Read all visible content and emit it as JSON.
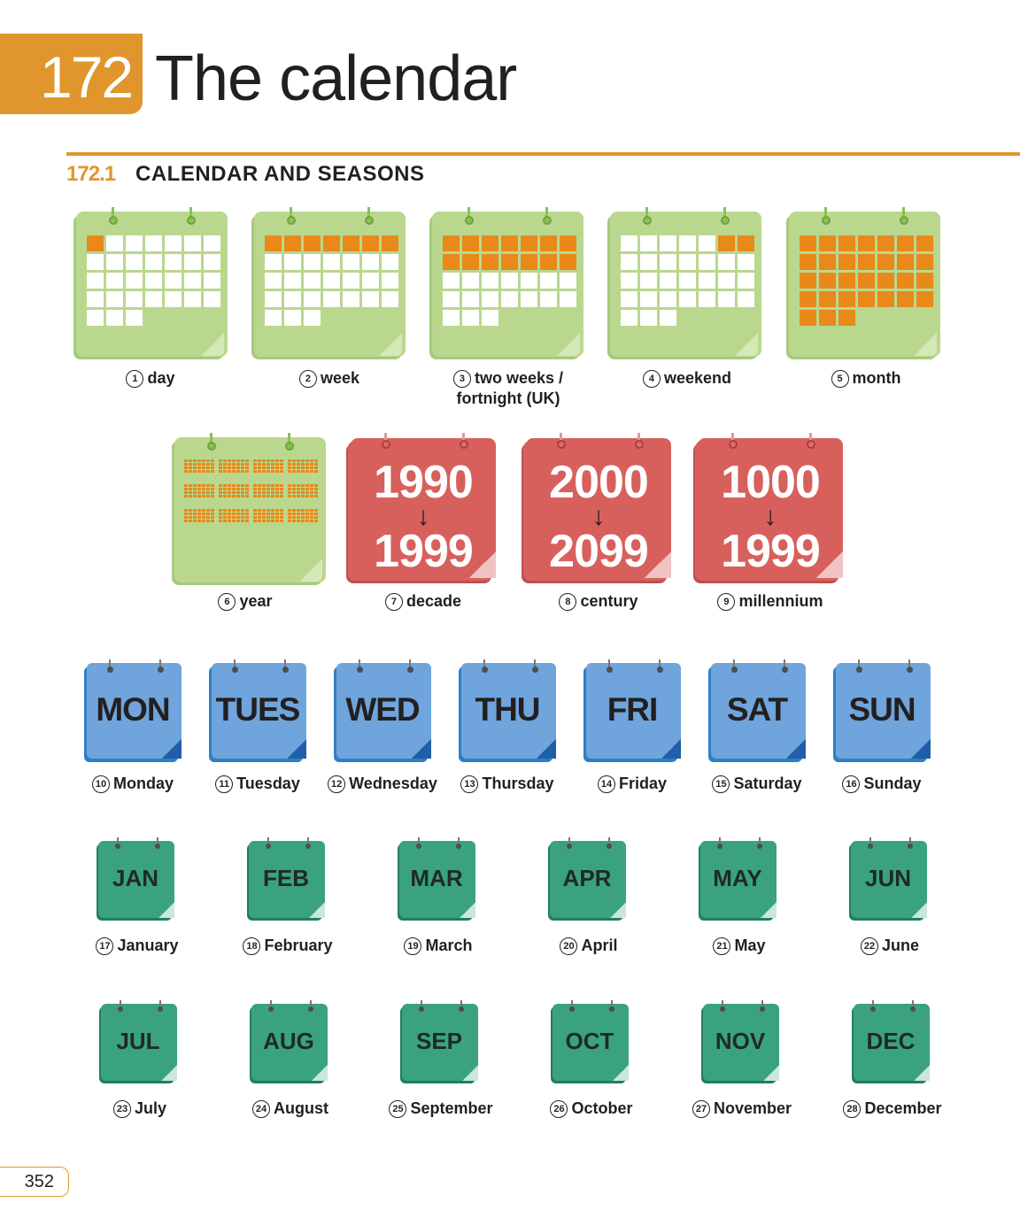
{
  "header": {
    "number": "172",
    "title": "The calendar"
  },
  "section": {
    "number": "172.1",
    "title": "CALENDAR AND SEASONS"
  },
  "periods": [
    {
      "n": "1",
      "label": "day",
      "fill": "day"
    },
    {
      "n": "2",
      "label": "week",
      "fill": "week"
    },
    {
      "n": "3",
      "label": "two weeks /",
      "label2": "fortnight (UK)",
      "fill": "twoweeks"
    },
    {
      "n": "4",
      "label": "weekend",
      "fill": "weekend"
    },
    {
      "n": "5",
      "label": "month",
      "fill": "month"
    },
    {
      "n": "6",
      "label": "year",
      "fill": "year"
    }
  ],
  "spans": [
    {
      "n": "7",
      "label": "decade",
      "from": "1990",
      "to": "1999"
    },
    {
      "n": "8",
      "label": "century",
      "from": "2000",
      "to": "2099"
    },
    {
      "n": "9",
      "label": "millennium",
      "from": "1000",
      "to": "1999"
    }
  ],
  "days": [
    {
      "n": "10",
      "abbr": "MON",
      "label": "Monday"
    },
    {
      "n": "11",
      "abbr": "TUES",
      "label": "Tuesday"
    },
    {
      "n": "12",
      "abbr": "WED",
      "label": "Wednesday"
    },
    {
      "n": "13",
      "abbr": "THU",
      "label": "Thursday"
    },
    {
      "n": "14",
      "abbr": "FRI",
      "label": "Friday"
    },
    {
      "n": "15",
      "abbr": "SAT",
      "label": "Saturday"
    },
    {
      "n": "16",
      "abbr": "SUN",
      "label": "Sunday"
    }
  ],
  "months": [
    {
      "n": "17",
      "abbr": "JAN",
      "label": "January"
    },
    {
      "n": "18",
      "abbr": "FEB",
      "label": "February"
    },
    {
      "n": "19",
      "abbr": "MAR",
      "label": "March"
    },
    {
      "n": "20",
      "abbr": "APR",
      "label": "April"
    },
    {
      "n": "21",
      "abbr": "MAY",
      "label": "May"
    },
    {
      "n": "22",
      "abbr": "JUN",
      "label": "June"
    },
    {
      "n": "23",
      "abbr": "JUL",
      "label": "July"
    },
    {
      "n": "24",
      "abbr": "AUG",
      "label": "August"
    },
    {
      "n": "25",
      "abbr": "SEP",
      "label": "September"
    },
    {
      "n": "26",
      "abbr": "OCT",
      "label": "October"
    },
    {
      "n": "27",
      "abbr": "NOV",
      "label": "November"
    },
    {
      "n": "28",
      "abbr": "DEC",
      "label": "December"
    }
  ],
  "page_number": "352",
  "colors": {
    "accent": "#e0962c",
    "green": "#b9d88e",
    "orange": "#e8891a",
    "red": "#d8605c",
    "blue": "#6fa4dc",
    "teal": "#3aa27f"
  }
}
